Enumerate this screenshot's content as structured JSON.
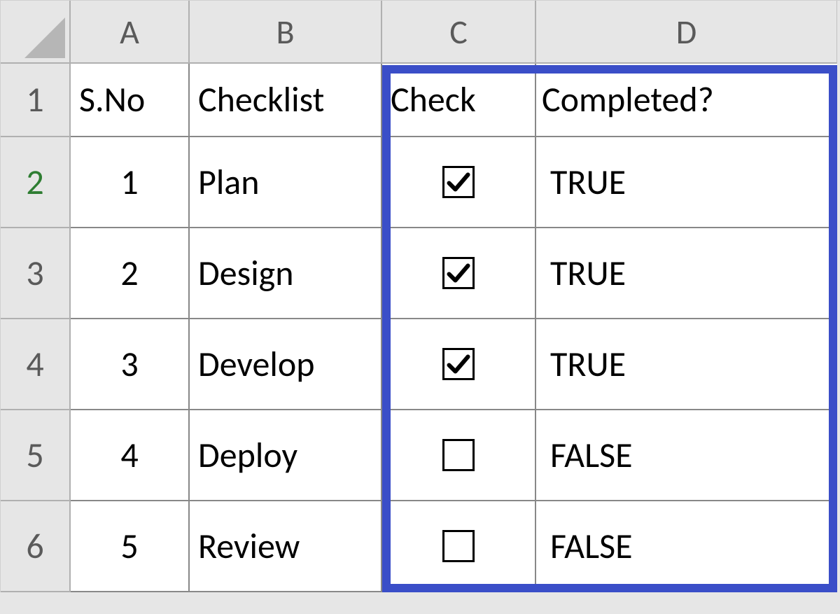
{
  "columns": {
    "A": "A",
    "B": "B",
    "C": "C",
    "D": "D"
  },
  "rowNumbers": [
    "1",
    "2",
    "3",
    "4",
    "5",
    "6"
  ],
  "headers": {
    "sno": "S.No",
    "checklist": "Checklist",
    "check": "Check",
    "completed": "Completed?"
  },
  "rows": [
    {
      "sno": "1",
      "checklist": "Plan",
      "checked": true,
      "completed": "TRUE"
    },
    {
      "sno": "2",
      "checklist": "Design",
      "checked": true,
      "completed": "TRUE"
    },
    {
      "sno": "3",
      "checklist": "Develop",
      "checked": true,
      "completed": "TRUE"
    },
    {
      "sno": "4",
      "checklist": "Deploy",
      "checked": false,
      "completed": "FALSE"
    },
    {
      "sno": "5",
      "checklist": "Review",
      "checked": false,
      "completed": "FALSE"
    }
  ],
  "highlightColor": "#3a4ec8",
  "activeRow": 2
}
